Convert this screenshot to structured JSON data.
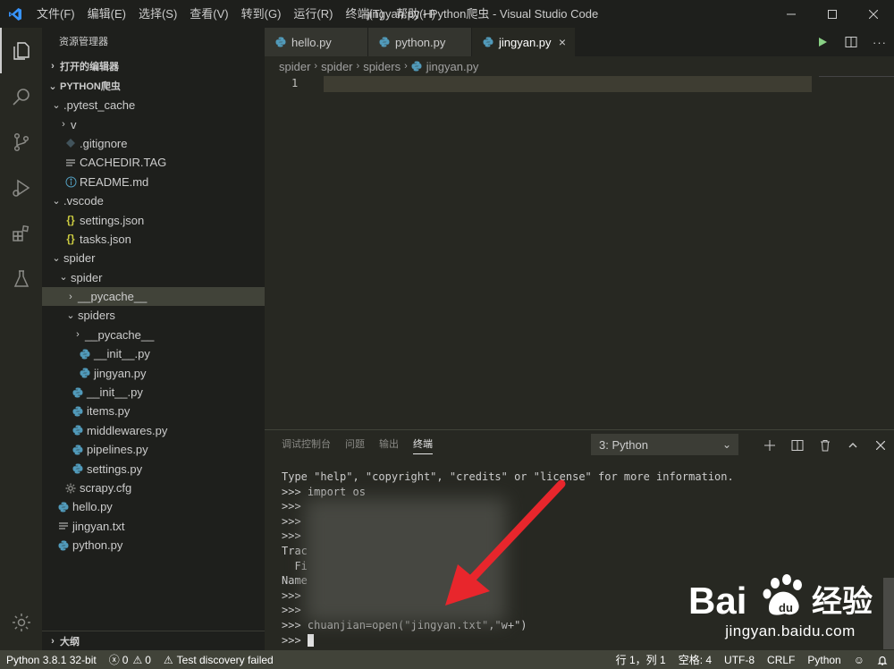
{
  "titlebar": {
    "menu": [
      "文件(F)",
      "编辑(E)",
      "选择(S)",
      "查看(V)",
      "转到(G)",
      "运行(R)",
      "终端(T)",
      "帮助(H)"
    ],
    "title": "jingyan.py - Python爬虫 - Visual Studio Code"
  },
  "sidebar": {
    "title": "资源管理器",
    "open_editors": "打开的编辑器",
    "project": "PYTHON爬虫",
    "tree": [
      {
        "label": ".pytest_cache",
        "indent": 1,
        "type": "folder-open"
      },
      {
        "label": "v",
        "indent": 2,
        "type": "folder-closed"
      },
      {
        "label": ".gitignore",
        "indent": 2,
        "type": "gitignore"
      },
      {
        "label": "CACHEDIR.TAG",
        "indent": 2,
        "type": "text"
      },
      {
        "label": "README.md",
        "indent": 2,
        "type": "info"
      },
      {
        "label": ".vscode",
        "indent": 1,
        "type": "folder-open"
      },
      {
        "label": "settings.json",
        "indent": 2,
        "type": "json"
      },
      {
        "label": "tasks.json",
        "indent": 2,
        "type": "json"
      },
      {
        "label": "spider",
        "indent": 1,
        "type": "folder-open"
      },
      {
        "label": "spider",
        "indent": 2,
        "type": "folder-open"
      },
      {
        "label": "__pycache__",
        "indent": 3,
        "type": "folder-closed",
        "selected": true
      },
      {
        "label": "spiders",
        "indent": 3,
        "type": "folder-open"
      },
      {
        "label": "__pycache__",
        "indent": 4,
        "type": "folder-closed"
      },
      {
        "label": "__init__.py",
        "indent": 4,
        "type": "python"
      },
      {
        "label": "jingyan.py",
        "indent": 4,
        "type": "python"
      },
      {
        "label": "__init__.py",
        "indent": 3,
        "type": "python"
      },
      {
        "label": "items.py",
        "indent": 3,
        "type": "python"
      },
      {
        "label": "middlewares.py",
        "indent": 3,
        "type": "python"
      },
      {
        "label": "pipelines.py",
        "indent": 3,
        "type": "python"
      },
      {
        "label": "settings.py",
        "indent": 3,
        "type": "python"
      },
      {
        "label": "scrapy.cfg",
        "indent": 2,
        "type": "gear"
      },
      {
        "label": "hello.py",
        "indent": 1,
        "type": "python"
      },
      {
        "label": "jingyan.txt",
        "indent": 1,
        "type": "text"
      },
      {
        "label": "python.py",
        "indent": 1,
        "type": "python"
      }
    ],
    "outline": "大纲"
  },
  "tabs": [
    {
      "label": "hello.py",
      "active": false
    },
    {
      "label": "python.py",
      "active": false
    },
    {
      "label": "jingyan.py",
      "active": true
    }
  ],
  "breadcrumb": [
    "spider",
    "spider",
    "spiders",
    "jingyan.py"
  ],
  "editor": {
    "line_number": "1"
  },
  "panel": {
    "tabs": [
      "调试控制台",
      "问题",
      "输出",
      "终端"
    ],
    "active_tab": "终端",
    "terminal_select": "3: Python",
    "lines": [
      "Type \"help\", \"copyright\", \"credits\" or \"license\" for more information.",
      ">>> import os",
      ">>>",
      ">>>",
      ">>>",
      "Trac",
      "  Fi",
      "Name",
      ">>>",
      ">>>",
      ">>> chuanjian=open(\"jingyan.txt\",\"w+\")",
      ">>> "
    ]
  },
  "statusbar": {
    "python": "Python 3.8.1 32-bit",
    "errors": "0",
    "warnings": "0",
    "test": "Test discovery failed",
    "position": "行 1，列 1",
    "spaces": "空格: 4",
    "encoding": "UTF-8",
    "eol": "CRLF",
    "language": "Python"
  },
  "watermark": {
    "brand": "Bai",
    "brand_cn": "经验",
    "url": "jingyan.baidu.com"
  },
  "colors": {
    "accent_blue": "#3794ff",
    "python_blue": "#519aba",
    "json_yellow": "#cbcb41",
    "arrow_red": "#e8262c"
  }
}
